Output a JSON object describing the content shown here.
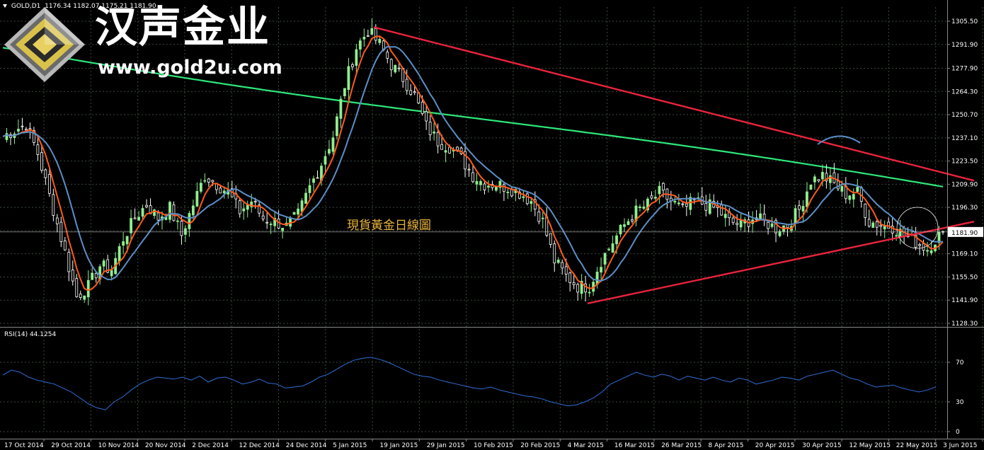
{
  "header": {
    "symbol": "GOLD,D1",
    "ohlc": "1176.34 1182.07 1175.21 1181.90"
  },
  "brand": {
    "name_cn": "汉声金业",
    "url": "www.gold2u.com"
  },
  "annotation": "現貨黃金日線圖",
  "price_badge": "1181.90",
  "rsi_header": "RSI(14) 44.1254",
  "colors": {
    "bull": "#90ee90",
    "bear": "#ffffff",
    "fast_ma": "#ff5a1e",
    "slow_ma": "#5b8fc7",
    "long_ma": "#2ee87a",
    "trend": "#e8243c",
    "rsi": "#2f6fd6",
    "grid": "#3a4a3a",
    "annotation": "#e8b43a"
  },
  "chart_data": [
    {
      "type": "candlestick",
      "title": "GOLD,D1",
      "ylim": [
        1128.3,
        1305.5
      ],
      "y_ticks": [
        "1305.50",
        "1291.90",
        "1277.90",
        "1264.30",
        "1250.70",
        "1237.10",
        "1223.50",
        "1209.90",
        "1196.30",
        "1182.70",
        "1169.10",
        "1155.50",
        "1141.90",
        "1128.30"
      ],
      "last_price": 1181.9,
      "x_tick_labels": [
        "17 Oct 2014",
        "29 Oct 2014",
        "10 Nov 2014",
        "20 Nov 2014",
        "2 Dec 2014",
        "12 Dec 2014",
        "24 Dec 2014",
        "5 Jan 2015",
        "19 Jan 2015",
        "29 Jan 2015",
        "10 Feb 2015",
        "20 Feb 2015",
        "4 Mar 2015",
        "16 Mar 2015",
        "26 Mar 2015",
        "8 Apr 2015",
        "20 Apr 2015",
        "30 Apr 2015",
        "12 May 2015",
        "22 May 2015",
        "3 Jun 2015"
      ],
      "close_path": [
        [
          0,
          1238
        ],
        [
          6,
          1245
        ],
        [
          9,
          1228
        ],
        [
          13,
          1195
        ],
        [
          16,
          1170
        ],
        [
          19,
          1144
        ],
        [
          22,
          1150
        ],
        [
          25,
          1162
        ],
        [
          28,
          1160
        ],
        [
          31,
          1178
        ],
        [
          34,
          1190
        ],
        [
          37,
          1198
        ],
        [
          40,
          1190
        ],
        [
          43,
          1196
        ],
        [
          46,
          1180
        ],
        [
          49,
          1198
        ],
        [
          52,
          1215
        ],
        [
          55,
          1210
        ],
        [
          58,
          1205
        ],
        [
          61,
          1194
        ],
        [
          64,
          1200
        ],
        [
          67,
          1190
        ],
        [
          70,
          1188
        ],
        [
          73,
          1185
        ],
        [
          76,
          1192
        ],
        [
          79,
          1208
        ],
        [
          82,
          1222
        ],
        [
          85,
          1238
        ],
        [
          88,
          1268
        ],
        [
          91,
          1290
        ],
        [
          94,
          1300
        ],
        [
          97,
          1292
        ],
        [
          100,
          1280
        ],
        [
          103,
          1272
        ],
        [
          106,
          1262
        ],
        [
          109,
          1244
        ],
        [
          112,
          1235
        ],
        [
          115,
          1232
        ],
        [
          118,
          1225
        ],
        [
          121,
          1215
        ],
        [
          124,
          1210
        ],
        [
          127,
          1210
        ],
        [
          130,
          1208
        ],
        [
          133,
          1205
        ],
        [
          136,
          1200
        ],
        [
          139,
          1188
        ],
        [
          142,
          1165
        ],
        [
          145,
          1156
        ],
        [
          148,
          1150
        ],
        [
          151,
          1150
        ],
        [
          154,
          1165
        ],
        [
          157,
          1176
        ],
        [
          160,
          1186
        ],
        [
          163,
          1194
        ],
        [
          166,
          1198
        ],
        [
          169,
          1205
        ],
        [
          172,
          1200
        ],
        [
          175,
          1195
        ],
        [
          178,
          1200
        ],
        [
          181,
          1198
        ],
        [
          184,
          1195
        ],
        [
          187,
          1188
        ],
        [
          190,
          1186
        ],
        [
          193,
          1190
        ],
        [
          196,
          1188
        ],
        [
          199,
          1184
        ],
        [
          202,
          1186
        ],
        [
          205,
          1195
        ],
        [
          208,
          1212
        ],
        [
          211,
          1215
        ],
        [
          214,
          1210
        ],
        [
          217,
          1204
        ],
        [
          220,
          1205
        ],
        [
          223,
          1188
        ],
        [
          226,
          1186
        ],
        [
          229,
          1185
        ],
        [
          232,
          1180
        ],
        [
          235,
          1176
        ],
        [
          238,
          1172
        ],
        [
          241,
          1180
        ],
        [
          242,
          1181.9
        ]
      ],
      "series": [
        {
          "name": "fast MA",
          "style": "orange line"
        },
        {
          "name": "slow MA",
          "style": "steel-blue line"
        },
        {
          "name": "long MA",
          "style": "green line"
        },
        {
          "name": "trendline upper",
          "points": [
            [
              "19 Jan 2015",
              1302
            ],
            [
              "end",
              1212
            ]
          ]
        },
        {
          "name": "trendline lower",
          "points": [
            [
              "16 Mar 2015",
              1140
            ],
            [
              "end",
              1188
            ]
          ]
        }
      ]
    },
    {
      "type": "line",
      "title": "RSI(14) 44.1254",
      "ylim": [
        0,
        100
      ],
      "y_ticks": [
        "70",
        "30",
        "0"
      ],
      "values": [
        57,
        62,
        60,
        55,
        52,
        50,
        48,
        44,
        40,
        34,
        28,
        24,
        22,
        30,
        35,
        42,
        48,
        52,
        55,
        54,
        53,
        55,
        52,
        56,
        50,
        54,
        55,
        52,
        48,
        50,
        53,
        49,
        48,
        44,
        45,
        46,
        50,
        55,
        58,
        63,
        68,
        72,
        74,
        75,
        73,
        70,
        66,
        62,
        58,
        56,
        55,
        52,
        50,
        48,
        46,
        44,
        43,
        45,
        42,
        40,
        38,
        36,
        35,
        33,
        30,
        28,
        26,
        27,
        30,
        34,
        40,
        48,
        52,
        56,
        60,
        57,
        55,
        58,
        56,
        52,
        56,
        54,
        52,
        55,
        52,
        50,
        54,
        52,
        48,
        50,
        52,
        55,
        54,
        52,
        56,
        58,
        60,
        62,
        58,
        54,
        52,
        48,
        45,
        46,
        47,
        44,
        42,
        40,
        42,
        45
      ],
      "last_value": 44.1254
    }
  ]
}
